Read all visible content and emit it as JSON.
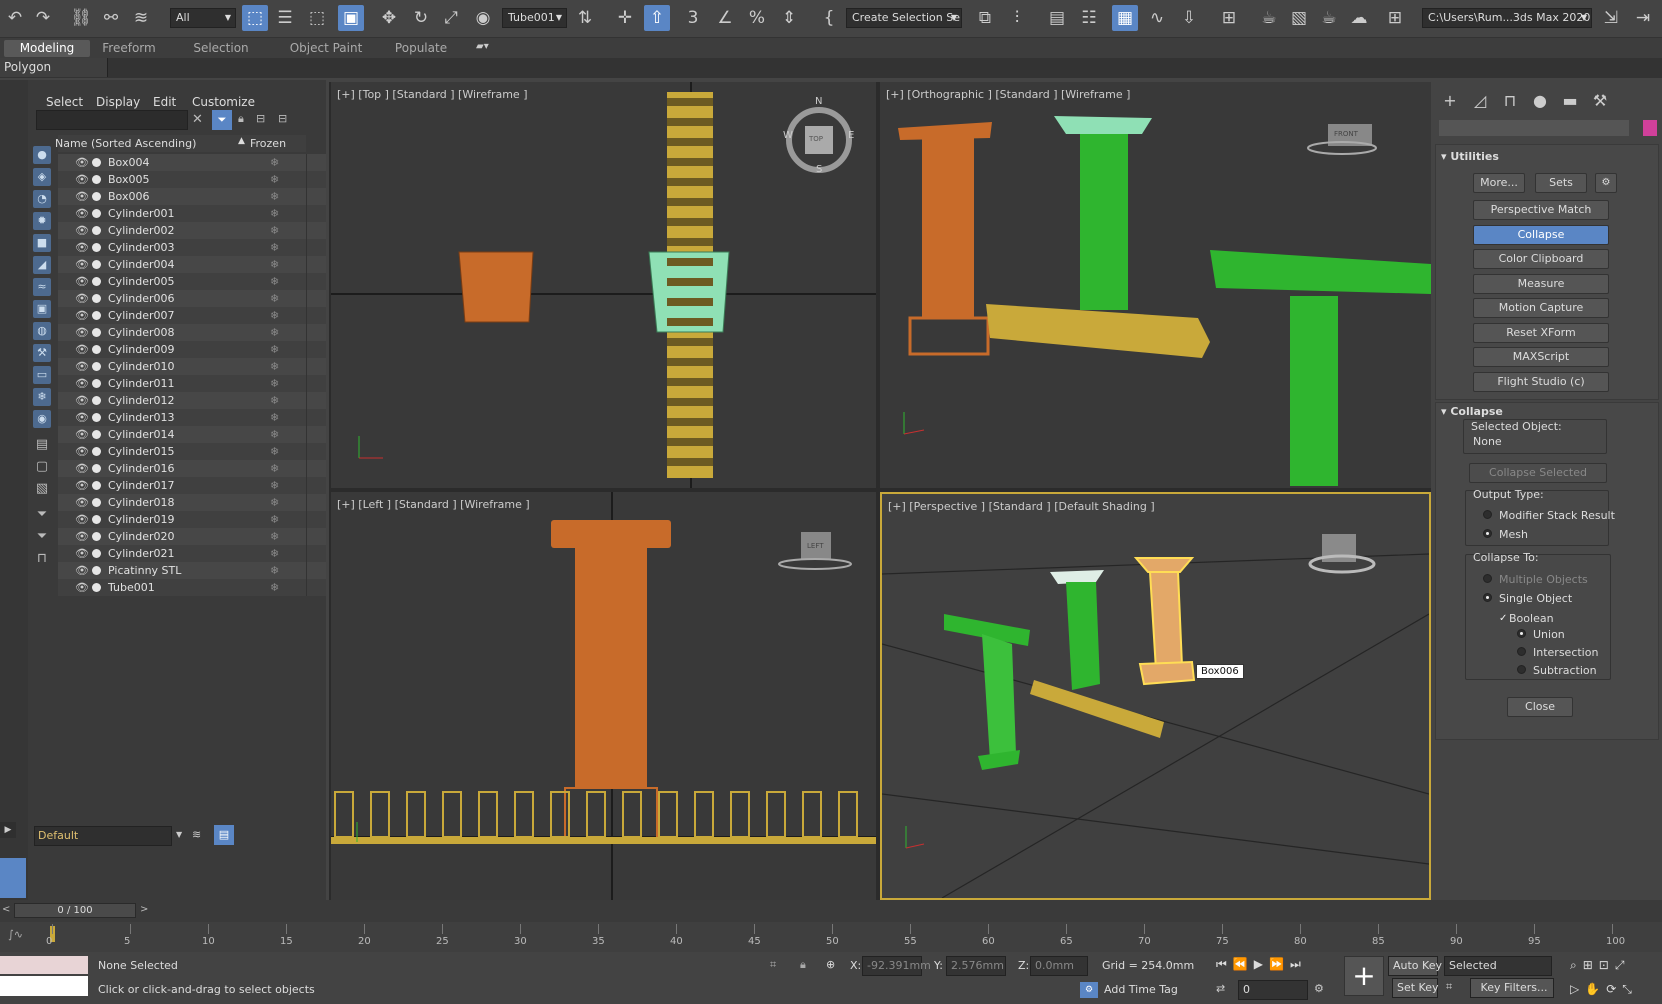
{
  "toolbar": {
    "filter": "All",
    "named_object": "Tube001",
    "selection_set": "Create Selection Se",
    "path": "C:\\Users\\Rum...3ds Max 2020"
  },
  "ribbon": {
    "tabs": [
      "Modeling",
      "Freeform",
      "Selection",
      "Object Paint",
      "Populate"
    ],
    "active_panel": "Polygon Modeling"
  },
  "explorer": {
    "menu": [
      "Select",
      "Display",
      "Edit",
      "Customize"
    ],
    "col_name": "Name (Sorted Ascending)",
    "col_frozen": "Frozen",
    "items": [
      "Box004",
      "Box005",
      "Box006",
      "Cylinder001",
      "Cylinder002",
      "Cylinder003",
      "Cylinder004",
      "Cylinder005",
      "Cylinder006",
      "Cylinder007",
      "Cylinder008",
      "Cylinder009",
      "Cylinder010",
      "Cylinder011",
      "Cylinder012",
      "Cylinder013",
      "Cylinder014",
      "Cylinder015",
      "Cylinder016",
      "Cylinder017",
      "Cylinder018",
      "Cylinder019",
      "Cylinder020",
      "Cylinder021",
      "Picatinny STL",
      "Tube001"
    ],
    "layer": "Default"
  },
  "viewports": {
    "top": "[+] [Top ] [Standard ] [Wireframe ]",
    "ortho": "[+] [Orthographic ] [Standard ] [Wireframe ]",
    "left": "[+] [Left ] [Standard ] [Wireframe ]",
    "persp": "[+] [Perspective ] [Standard ] [Default Shading ]",
    "tooltip": "Box006",
    "cube_top": "TOP",
    "cube_left": "LEFT",
    "cube_front": "FRONT",
    "compass": {
      "n": "N",
      "s": "S",
      "e": "E",
      "w": "W"
    }
  },
  "utilities": {
    "title": "Utilities",
    "more": "More...",
    "sets": "Sets",
    "buttons": [
      "Perspective Match",
      "Collapse",
      "Color Clipboard",
      "Measure",
      "Motion Capture",
      "Reset XForm",
      "MAXScript",
      "Flight Studio (c)"
    ],
    "active": "Collapse"
  },
  "collapse": {
    "title": "Collapse",
    "selected_label": "Selected Object:",
    "selected_value": "None",
    "collapse_selected": "Collapse Selected",
    "output_label": "Output Type:",
    "output_opts": [
      "Modifier Stack Result",
      "Mesh"
    ],
    "to_label": "Collapse To:",
    "to_opts": [
      "Multiple Objects",
      "Single Object"
    ],
    "boolean": "Boolean",
    "bool_opts": [
      "Union",
      "Intersection",
      "Subtraction"
    ],
    "close": "Close"
  },
  "timeline": {
    "frame": "0 / 100",
    "ticks": [
      "0",
      "5",
      "10",
      "15",
      "20",
      "25",
      "30",
      "35",
      "40",
      "45",
      "50",
      "55",
      "60",
      "65",
      "70",
      "75",
      "80",
      "85",
      "90",
      "95",
      "100"
    ]
  },
  "status": {
    "selected": "None Selected",
    "prompt": "Click or click-and-drag to select objects",
    "x_label": "X:",
    "x": "-92.391mm",
    "y_label": "Y:",
    "y": "2.576mm",
    "z_label": "Z:",
    "z": "0.0mm",
    "grid": "Grid = 254.0mm",
    "time_tag": "Add Time Tag",
    "auto_key": "Auto Key",
    "set_key": "Set Key",
    "key_mode": "Selected",
    "key_filters": "Key Filters...",
    "frame": "0"
  },
  "colors": {
    "accent": "#5a86c5",
    "orange": "#c86b2a",
    "green": "#2fb52f",
    "yellow": "#c9a93a",
    "mint": "#8fe0b5"
  }
}
